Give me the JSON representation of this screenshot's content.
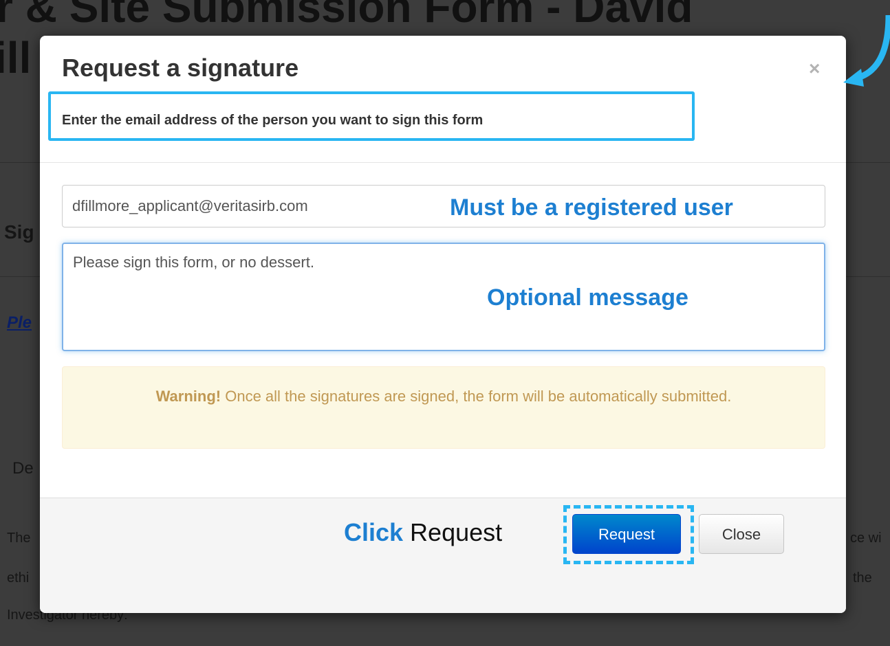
{
  "background": {
    "title_line1": "r & Site Submission Form - David",
    "title_line2": "ill",
    "section_heading": "Sig",
    "link_fragment": "Ple",
    "text_fragment_de": "De",
    "body_line1_left": "The",
    "body_line1_right": "ce wi",
    "body_line2_left": "ethi",
    "body_line2_right": "the",
    "body_line3_left": "Investigator hereby:"
  },
  "modal": {
    "title": "Request a signature",
    "close_glyph": "×",
    "subtitle": "Enter the email address of the person you want to sign this form",
    "email": {
      "value": "dfillmore_applicant@veritasirb.com",
      "annotation": "Must be a registered user"
    },
    "message": {
      "value": "Please sign this form, or no dessert.",
      "annotation": "Optional message"
    },
    "alert": {
      "strong": "Warning!",
      "text": " Once all the signatures are signed, the form will be automatically submitted."
    },
    "footer": {
      "click_keyword": "Click",
      "click_rest": " Request",
      "request_label": "Request",
      "close_label": "Close"
    }
  },
  "colors": {
    "highlight": "#29b6f2",
    "annotation": "#1d7fd1",
    "primary_button": "#0055cc",
    "alert_bg": "#fcf8e3",
    "alert_text": "#c09853"
  }
}
